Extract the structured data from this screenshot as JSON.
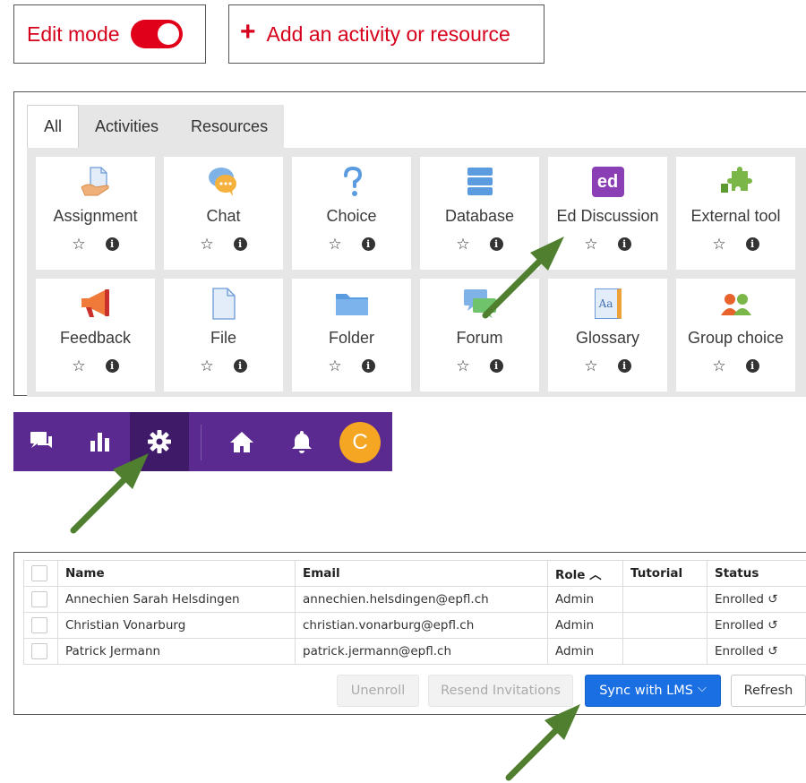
{
  "edit_mode": {
    "label": "Edit mode",
    "enabled": true,
    "color": "#e0001a"
  },
  "add_activity": {
    "icon": "plus-icon",
    "label": "Add an activity or resource"
  },
  "chooser": {
    "tabs": [
      "All",
      "Activities",
      "Resources"
    ],
    "active_tab": "All",
    "modules": [
      {
        "name": "Assignment",
        "icon": "assignment-icon"
      },
      {
        "name": "Chat",
        "icon": "chat-icon"
      },
      {
        "name": "Choice",
        "icon": "choice-icon"
      },
      {
        "name": "Database",
        "icon": "database-icon"
      },
      {
        "name": "Ed Discussion",
        "icon": "ed-discussion-icon",
        "icon_text": "ed"
      },
      {
        "name": "External tool",
        "icon": "puzzle-icon"
      },
      {
        "name": "Feedback",
        "icon": "megaphone-icon"
      },
      {
        "name": "File",
        "icon": "file-icon"
      },
      {
        "name": "Folder",
        "icon": "folder-icon"
      },
      {
        "name": "Forum",
        "icon": "forum-icon"
      },
      {
        "name": "Glossary",
        "icon": "glossary-icon",
        "icon_text": "Aa"
      },
      {
        "name": "Group choice",
        "icon": "group-choice-icon"
      }
    ],
    "star_glyph": "☆",
    "info_glyph": "i"
  },
  "navbar": {
    "color": "#5b2a91",
    "icons": [
      "discussion-icon",
      "analytics-icon",
      "settings-icon",
      "home-icon",
      "bell-icon"
    ],
    "active": "settings-icon",
    "avatar_initial": "C",
    "avatar_color": "#f5a623"
  },
  "members": {
    "columns": [
      "Name",
      "Email",
      "Role ︿",
      "Tutorial",
      "Status"
    ],
    "rows": [
      {
        "name": "Annechien Sarah Helsdingen",
        "email": "annechien.helsdingen@epfl.ch",
        "role": "Admin",
        "tutorial": "",
        "status": "Enrolled ↺"
      },
      {
        "name": "Christian Vonarburg",
        "email": "christian.vonarburg@epfl.ch",
        "role": "Admin",
        "tutorial": "",
        "status": "Enrolled ↺"
      },
      {
        "name": "Patrick Jermann",
        "email": "patrick.jermann@epfl.ch",
        "role": "Admin",
        "tutorial": "",
        "status": "Enrolled ↺"
      }
    ],
    "buttons": {
      "unenroll": "Unenroll",
      "resend": "Resend Invitations",
      "sync": "Sync with LMS",
      "sync_chevron": "⌵",
      "refresh": "Refresh"
    }
  },
  "annotation_arrow_color": "#4f7f2f"
}
